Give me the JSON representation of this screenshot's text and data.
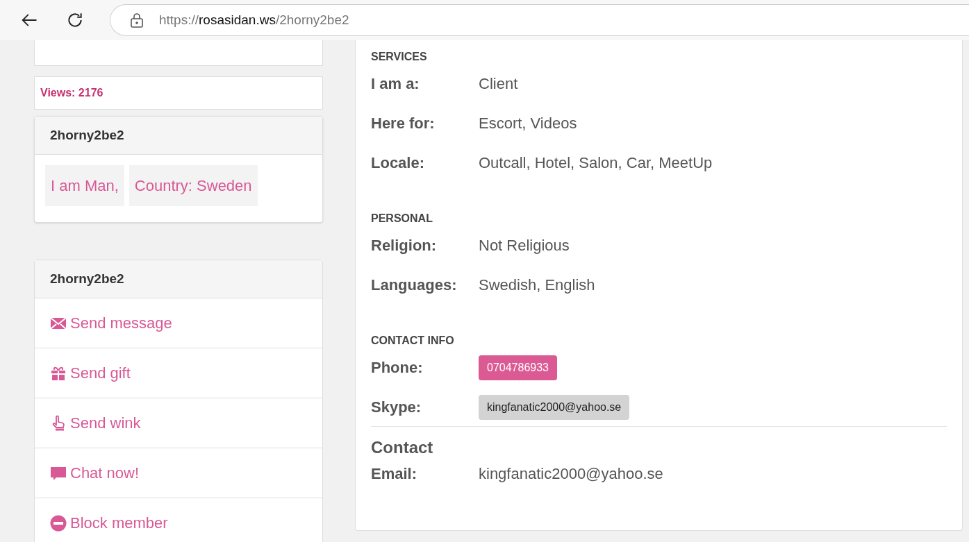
{
  "browser": {
    "url": {
      "scheme": "https://",
      "host": "rosasidan.ws",
      "path": "/2horny2be2"
    }
  },
  "views": "Views: 2176",
  "profile_card": {
    "title": "2horny2be2",
    "tags": [
      "I am Man,",
      "Country: Sweden"
    ]
  },
  "actions_card": {
    "title": "2horny2be2",
    "items": [
      {
        "kind": "message",
        "label": "Send message"
      },
      {
        "kind": "gift",
        "label": "Send gift"
      },
      {
        "kind": "wink",
        "label": "Send wink"
      },
      {
        "kind": "chat",
        "label": "Chat now!"
      },
      {
        "kind": "block",
        "label": "Block member"
      }
    ]
  },
  "sections": [
    {
      "heading": "SERVICES",
      "rows": [
        {
          "kind": "text",
          "label": "I am a:",
          "value": "Client"
        },
        {
          "kind": "text",
          "label": "Here for:",
          "value": "Escort, Videos"
        },
        {
          "kind": "text",
          "label": "Locale:",
          "value": "Outcall, Hotel, Salon, Car, MeetUp"
        }
      ]
    },
    {
      "heading": "PERSONAL",
      "rows": [
        {
          "kind": "text",
          "label": "Religion:",
          "value": "Not Religious"
        },
        {
          "kind": "text",
          "label": "Languages:",
          "value": "Swedish, English"
        }
      ]
    },
    {
      "heading": "CONTACT INFO",
      "rows": [
        {
          "kind": "badge",
          "label": "Phone:",
          "value": "0704786933",
          "color": "#dc5a94"
        },
        {
          "kind": "badge",
          "label": "Skype:",
          "value": "kingfanatic2000@yahoo.se",
          "color": "#d3d3d3"
        }
      ]
    }
  ],
  "contact": {
    "title": "Contact",
    "rows": [
      {
        "label": "Email:",
        "value": "kingfanatic2000@yahoo.se"
      }
    ]
  }
}
